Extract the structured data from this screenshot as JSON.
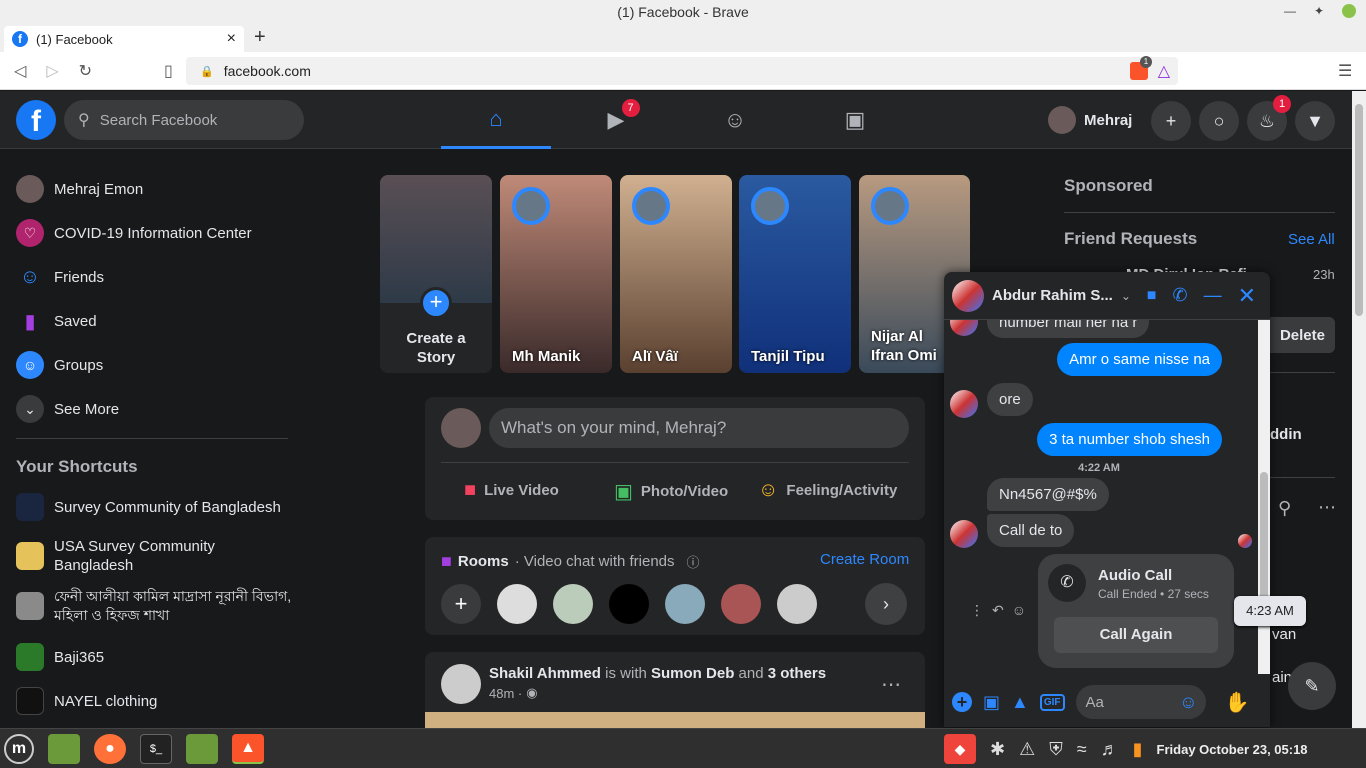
{
  "window": {
    "title": "(1) Facebook - Brave"
  },
  "tab": {
    "title": "(1) Facebook",
    "close": "×",
    "new": "+"
  },
  "browser": {
    "url": "facebook.com",
    "shield_count": "1"
  },
  "header": {
    "search_placeholder": "Search Facebook",
    "watch_badge": "7",
    "profile_name": "Mehraj",
    "notif_badge": "1"
  },
  "sidebar": {
    "items": [
      {
        "label": "Mehraj Emon"
      },
      {
        "label": "COVID-19 Information Center"
      },
      {
        "label": "Friends"
      },
      {
        "label": "Saved"
      },
      {
        "label": "Groups"
      },
      {
        "label": "See More"
      }
    ],
    "shortcuts_title": "Your Shortcuts",
    "shortcuts": [
      {
        "label": "Survey Community of Bangladesh"
      },
      {
        "label": "USA Survey Community Bangladesh"
      },
      {
        "label": "ফেনী আলীয়া কামিল মাদ্রাসা নূরানী বিভাগ, মহিলা ও হিফজ শাখা"
      },
      {
        "label": "Baji365"
      },
      {
        "label": "NAYEL clothing"
      }
    ]
  },
  "stories": [
    {
      "name": "Create a Story"
    },
    {
      "name": "Mh Manik"
    },
    {
      "name": "Alï Vâï"
    },
    {
      "name": "Tanjil Tipu"
    },
    {
      "name": "Nijar Al Ifran Omi"
    }
  ],
  "composer": {
    "placeholder": "What's on your mind, Mehraj?",
    "live": "Live Video",
    "photo": "Photo/Video",
    "feeling": "Feeling/Activity"
  },
  "rooms": {
    "title": "Rooms",
    "subtitle": "· Video chat with friends",
    "create": "Create Room"
  },
  "post": {
    "author": "Shakil Ahmmed",
    "with_text": "is with",
    "tagged": "Sumon Deb",
    "and": "and",
    "others": "3 others",
    "time": "48m ·"
  },
  "right": {
    "sponsored": "Sponsored",
    "friend_requests": "Friend Requests",
    "see_all": "See All",
    "fr_time": "23h",
    "fr_name": "MD Dirul Ion Rafi",
    "delete_partial": "Delete",
    "partial_1": "ddin",
    "partial_2": "van",
    "partial_3": "ain"
  },
  "chat": {
    "name": "Abdur Rahim S...",
    "messages": [
      {
        "text": "number mail her na r",
        "dir": "in"
      },
      {
        "text": "Amr o same nisse na",
        "dir": "out"
      },
      {
        "text": "ore",
        "dir": "in"
      },
      {
        "text": "3 ta number shob shesh",
        "dir": "out"
      },
      {
        "text": "Nn4567@#$%",
        "dir": "in"
      },
      {
        "text": "Call de to",
        "dir": "in"
      }
    ],
    "timestamp": "4:22 AM",
    "call_title": "Audio Call",
    "call_status": "Call Ended • 27 secs",
    "call_again": "Call Again",
    "tooltip": "4:23 AM",
    "input_placeholder": "Aa",
    "gif": "GIF"
  },
  "taskbar": {
    "clock": "Friday October 23, 05:18"
  }
}
